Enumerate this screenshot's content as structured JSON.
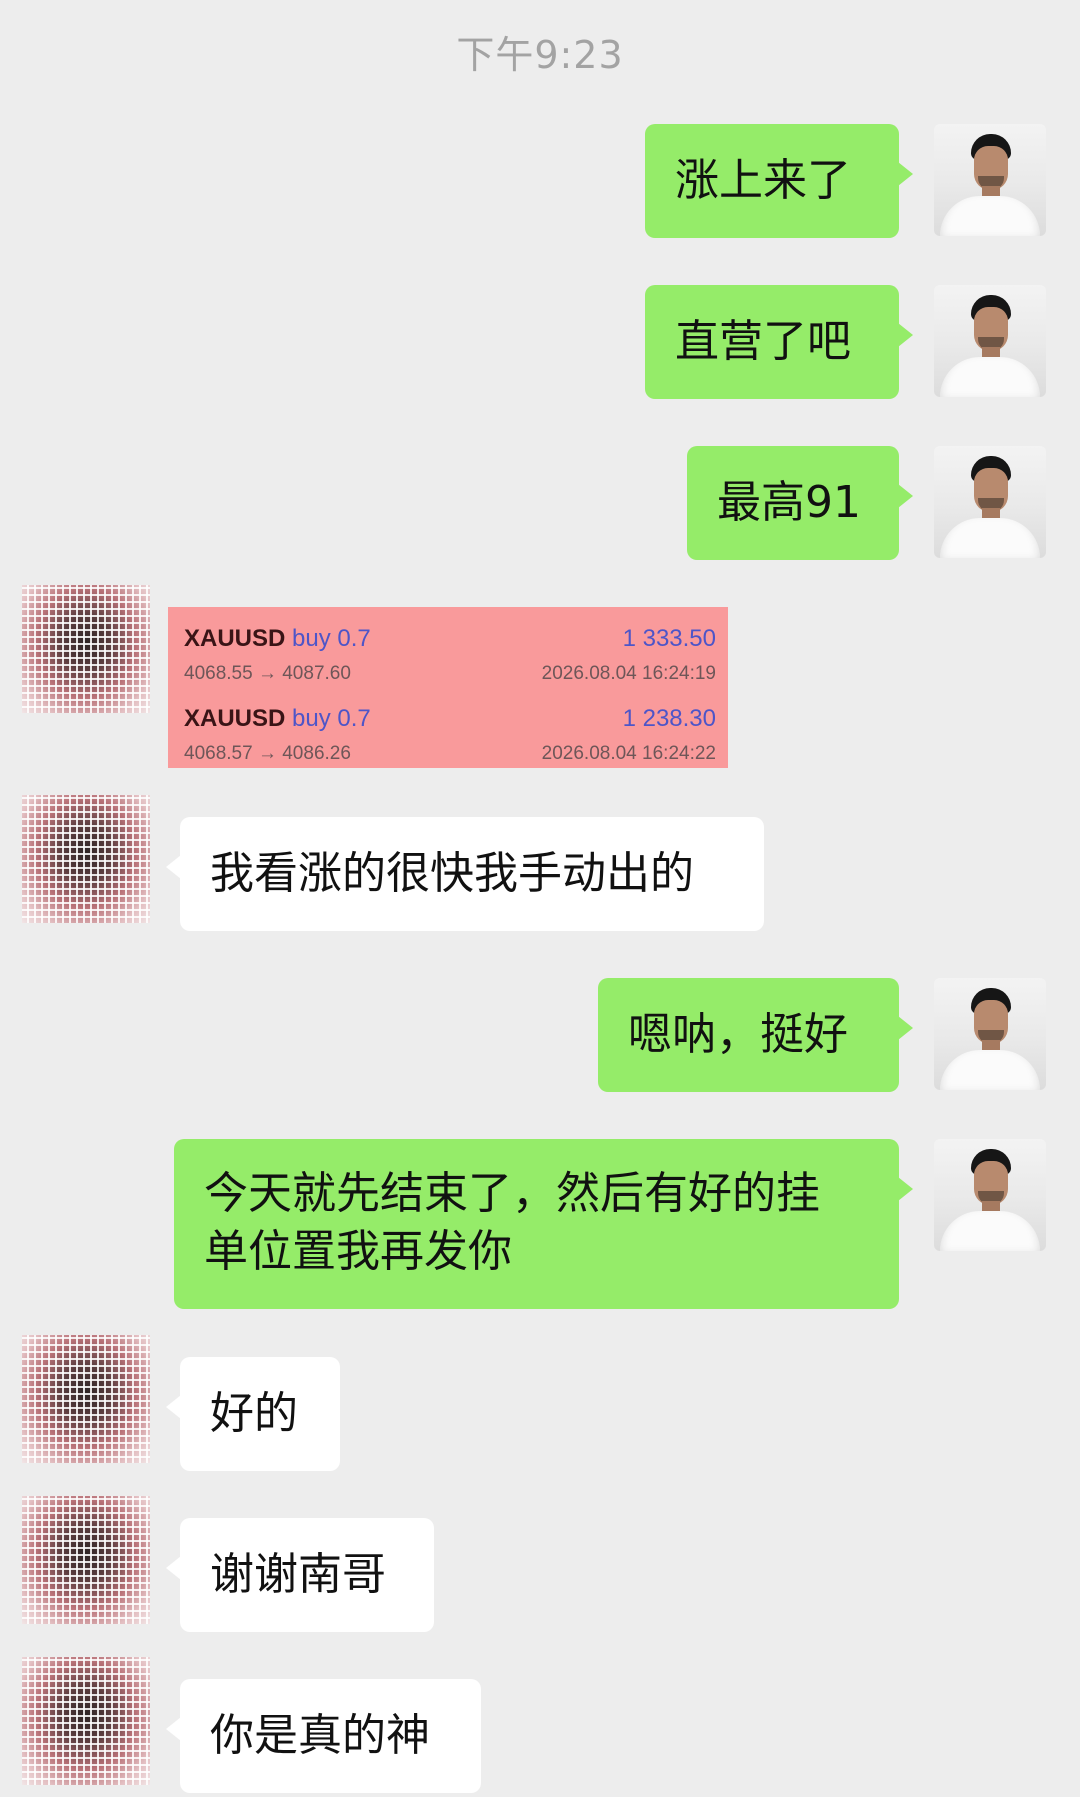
{
  "header": {
    "timestamp": "下午9:23"
  },
  "messages": [
    {
      "side": "right",
      "text": "涨上来了"
    },
    {
      "side": "right",
      "text": "直营了吧"
    },
    {
      "side": "right",
      "text": "最高91"
    },
    {
      "side": "left",
      "type": "trade-screenshot"
    },
    {
      "side": "left",
      "text": "我看涨的很快我手动出的"
    },
    {
      "side": "right",
      "text": "嗯呐，挺好"
    },
    {
      "side": "right",
      "text_line1": "今天就先结束了，然后有好的挂",
      "text_line2": "单位置我再发你"
    },
    {
      "side": "left",
      "text": "好的"
    },
    {
      "side": "left",
      "text": "谢谢南哥"
    },
    {
      "side": "left",
      "text": "你是真的神"
    }
  ],
  "trades": [
    {
      "symbol": "XAUUSD",
      "side": "buy 0.7",
      "profit": "1 333.50",
      "prices": "4068.55 → 4087.60",
      "time": "2026.08.04 16:24:19"
    },
    {
      "symbol": "XAUUSD",
      "side": "buy 0.7",
      "profit": "1 238.30",
      "prices": "4068.57 → 4086.26",
      "time": "2026.08.04 16:24:22"
    }
  ],
  "colors": {
    "background": "#ededed",
    "sent_bubble": "#95ec69",
    "received_bubble": "#ffffff",
    "trade_card": "#f99a9b",
    "trade_accent": "#4d55c8"
  },
  "icons": {
    "right_avatar": "avatar-man-white-tshirt",
    "left_avatar": "avatar-pixelated"
  }
}
